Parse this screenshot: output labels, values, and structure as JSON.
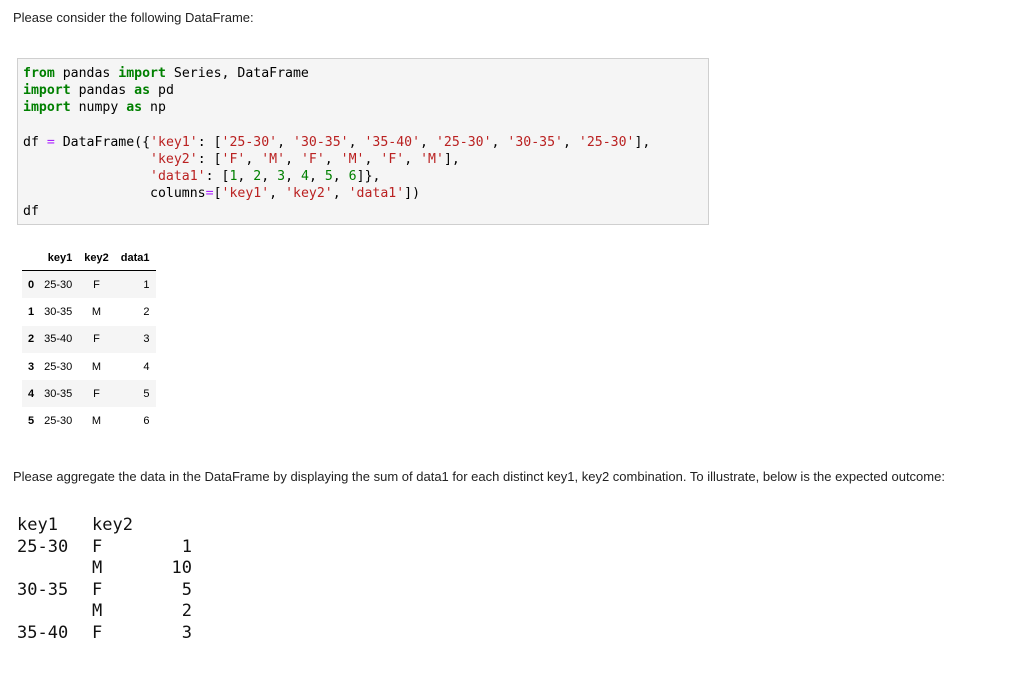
{
  "intro_text": "Please consider the following DataFrame:",
  "code_cell": {
    "lines": [
      [
        {
          "t": "kw",
          "v": "from"
        },
        {
          "t": "",
          "v": " pandas "
        },
        {
          "t": "kw",
          "v": "import"
        },
        {
          "t": "",
          "v": " Series, DataFrame"
        }
      ],
      [
        {
          "t": "kw",
          "v": "import"
        },
        {
          "t": "",
          "v": " pandas "
        },
        {
          "t": "kw",
          "v": "as"
        },
        {
          "t": "",
          "v": " pd"
        }
      ],
      [
        {
          "t": "kw",
          "v": "import"
        },
        {
          "t": "",
          "v": " numpy "
        },
        {
          "t": "kw",
          "v": "as"
        },
        {
          "t": "",
          "v": " np"
        }
      ],
      [
        {
          "t": "",
          "v": ""
        }
      ],
      [
        {
          "t": "",
          "v": "df "
        },
        {
          "t": "op",
          "v": "="
        },
        {
          "t": "",
          "v": " DataFrame({"
        },
        {
          "t": "str",
          "v": "'key1'"
        },
        {
          "t": "",
          "v": ": ["
        },
        {
          "t": "str",
          "v": "'25-30'"
        },
        {
          "t": "",
          "v": ", "
        },
        {
          "t": "str",
          "v": "'30-35'"
        },
        {
          "t": "",
          "v": ", "
        },
        {
          "t": "str",
          "v": "'35-40'"
        },
        {
          "t": "",
          "v": ", "
        },
        {
          "t": "str",
          "v": "'25-30'"
        },
        {
          "t": "",
          "v": ", "
        },
        {
          "t": "str",
          "v": "'30-35'"
        },
        {
          "t": "",
          "v": ", "
        },
        {
          "t": "str",
          "v": "'25-30'"
        },
        {
          "t": "",
          "v": "],"
        }
      ],
      [
        {
          "t": "",
          "v": "                "
        },
        {
          "t": "str",
          "v": "'key2'"
        },
        {
          "t": "",
          "v": ": ["
        },
        {
          "t": "str",
          "v": "'F'"
        },
        {
          "t": "",
          "v": ", "
        },
        {
          "t": "str",
          "v": "'M'"
        },
        {
          "t": "",
          "v": ", "
        },
        {
          "t": "str",
          "v": "'F'"
        },
        {
          "t": "",
          "v": ", "
        },
        {
          "t": "str",
          "v": "'M'"
        },
        {
          "t": "",
          "v": ", "
        },
        {
          "t": "str",
          "v": "'F'"
        },
        {
          "t": "",
          "v": ", "
        },
        {
          "t": "str",
          "v": "'M'"
        },
        {
          "t": "",
          "v": "],"
        }
      ],
      [
        {
          "t": "",
          "v": "                "
        },
        {
          "t": "str",
          "v": "'data1'"
        },
        {
          "t": "",
          "v": ": ["
        },
        {
          "t": "num",
          "v": "1"
        },
        {
          "t": "",
          "v": ", "
        },
        {
          "t": "num",
          "v": "2"
        },
        {
          "t": "",
          "v": ", "
        },
        {
          "t": "num",
          "v": "3"
        },
        {
          "t": "",
          "v": ", "
        },
        {
          "t": "num",
          "v": "4"
        },
        {
          "t": "",
          "v": ", "
        },
        {
          "t": "num",
          "v": "5"
        },
        {
          "t": "",
          "v": ", "
        },
        {
          "t": "num",
          "v": "6"
        },
        {
          "t": "",
          "v": "]},"
        }
      ],
      [
        {
          "t": "",
          "v": "                columns"
        },
        {
          "t": "op",
          "v": "="
        },
        {
          "t": "",
          "v": "["
        },
        {
          "t": "str",
          "v": "'key1'"
        },
        {
          "t": "",
          "v": ", "
        },
        {
          "t": "str",
          "v": "'key2'"
        },
        {
          "t": "",
          "v": ", "
        },
        {
          "t": "str",
          "v": "'data1'"
        },
        {
          "t": "",
          "v": "])"
        }
      ],
      [
        {
          "t": "",
          "v": "df"
        }
      ]
    ]
  },
  "dataframe": {
    "columns": [
      "key1",
      "key2",
      "data1"
    ],
    "rows": [
      {
        "index": "0",
        "key1": "25-30",
        "key2": "F",
        "data1": "1"
      },
      {
        "index": "1",
        "key1": "30-35",
        "key2": "M",
        "data1": "2"
      },
      {
        "index": "2",
        "key1": "35-40",
        "key2": "F",
        "data1": "3"
      },
      {
        "index": "3",
        "key1": "25-30",
        "key2": "M",
        "data1": "4"
      },
      {
        "index": "4",
        "key1": "30-35",
        "key2": "F",
        "data1": "5"
      },
      {
        "index": "5",
        "key1": "25-30",
        "key2": "M",
        "data1": "6"
      }
    ]
  },
  "instruction_text": "Please aggregate the data in the DataFrame by displaying the sum of data1 for each distinct key1, key2 combination.  To illustrate, below is the expected outcome:",
  "expected_result": {
    "header": {
      "key1": "key1",
      "key2": "key2"
    },
    "rows": [
      {
        "key1": "25-30",
        "key2": "F",
        "value": "1"
      },
      {
        "key1": "",
        "key2": "M",
        "value": "10"
      },
      {
        "key1": "30-35",
        "key2": "F",
        "value": "5"
      },
      {
        "key1": "",
        "key2": "M",
        "value": "2"
      },
      {
        "key1": "35-40",
        "key2": "F",
        "value": "3"
      }
    ]
  }
}
